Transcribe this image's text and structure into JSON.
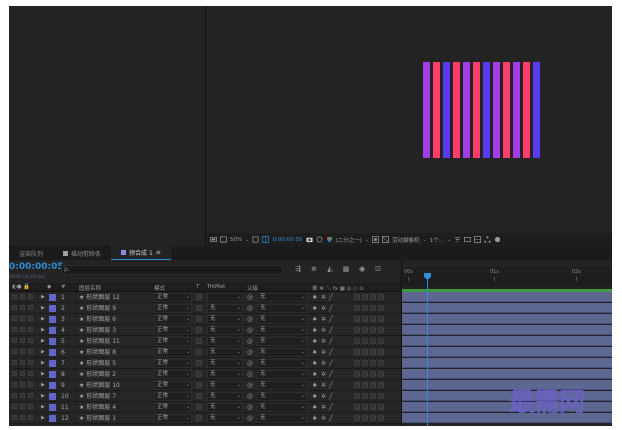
{
  "viewer": {
    "stripe_colors": [
      "#a23ee8",
      "#ff3d6a",
      "#5a3cf0",
      "#ff3d6a",
      "#a23ee8",
      "#ff3d6a",
      "#5a3cf0",
      "#a23ee8",
      "#ff3d6a",
      "#a23ee8",
      "#ff3d6a",
      "#5a3cf0"
    ]
  },
  "viewer_bar": {
    "zoom": "50%",
    "timecode": "0:00:00:05",
    "resolution": "(二分之一)",
    "camera": "活动摄像机",
    "views": "1个..."
  },
  "tabs": [
    {
      "label": "渲染队列",
      "swatch": ""
    },
    {
      "label": "描动剪映条",
      "swatch": "#a0a0a0"
    },
    {
      "label": "预合成 1",
      "swatch": "#8a8ae0",
      "active": true
    }
  ],
  "timecode": {
    "value": "0:00:00:05",
    "frames": "00005 (25.00 fps)"
  },
  "search": {
    "placeholder": "ρ."
  },
  "columns": {
    "num": "#",
    "name": "图层名称",
    "mode": "模式",
    "t": "T",
    "trkmat": "TrkMat",
    "parent": "父级",
    "switches": "单 ✲ ＼ fx ▦ ◎ ◇ ⊙"
  },
  "layers": [
    {
      "num": "1",
      "name": "★ 形状图层 12",
      "mode": "正常",
      "trkmat": "",
      "parent": "无"
    },
    {
      "num": "2",
      "name": "★ 形状图层 9",
      "mode": "正常",
      "trkmat": "无",
      "parent": "无"
    },
    {
      "num": "3",
      "name": "★ 形状图层 6",
      "mode": "正常",
      "trkmat": "无",
      "parent": "无"
    },
    {
      "num": "4",
      "name": "★ 形状图层 3",
      "mode": "正常",
      "trkmat": "无",
      "parent": "无"
    },
    {
      "num": "5",
      "name": "★ 形状图层 11",
      "mode": "正常",
      "trkmat": "无",
      "parent": "无"
    },
    {
      "num": "6",
      "name": "★ 形状图层 8",
      "mode": "正常",
      "trkmat": "无",
      "parent": "无"
    },
    {
      "num": "7",
      "name": "★ 形状图层 5",
      "mode": "正常",
      "trkmat": "无",
      "parent": "无"
    },
    {
      "num": "8",
      "name": "★ 形状图层 2",
      "mode": "正常",
      "trkmat": "无",
      "parent": "无"
    },
    {
      "num": "9",
      "name": "★ 形状图层 10",
      "mode": "正常",
      "trkmat": "无",
      "parent": "无"
    },
    {
      "num": "10",
      "name": "★ 形状图层 7",
      "mode": "正常",
      "trkmat": "无",
      "parent": "无"
    },
    {
      "num": "11",
      "name": "★ 形状图层 4",
      "mode": "正常",
      "trkmat": "无",
      "parent": "无"
    },
    {
      "num": "12",
      "name": "★ 形状图层 1",
      "mode": "正常",
      "trkmat": "无",
      "parent": "无"
    }
  ],
  "ruler": {
    "ticks": [
      "00s",
      "01s",
      "02s"
    ]
  },
  "watermark": "最需网",
  "colors": {
    "accent": "#2e8ed6",
    "label": "#5f66c5",
    "layer_bar": "#5d6791",
    "work_area": "#3e9a3e"
  }
}
